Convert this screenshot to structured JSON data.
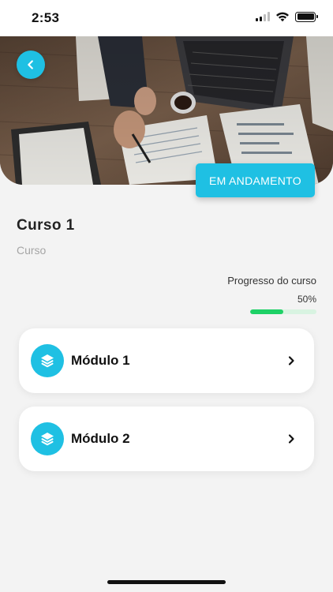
{
  "status_bar": {
    "time": "2:53"
  },
  "header": {
    "back_icon": "chevron-left-icon",
    "status_chip": "EM ANDAMENTO"
  },
  "course": {
    "title": "Curso 1",
    "subtitle": "Curso"
  },
  "progress": {
    "label": "Progresso do curso",
    "percent_text": "50%",
    "value": 0.5
  },
  "modules": [
    {
      "label": "Módulo 1",
      "icon": "layers-icon"
    },
    {
      "label": "Módulo 2",
      "icon": "layers-icon"
    }
  ],
  "colors": {
    "accent": "#1fc0e3",
    "progress_fill": "#1ed166",
    "progress_track": "#d8f3e1",
    "background": "#f3f3f3"
  }
}
